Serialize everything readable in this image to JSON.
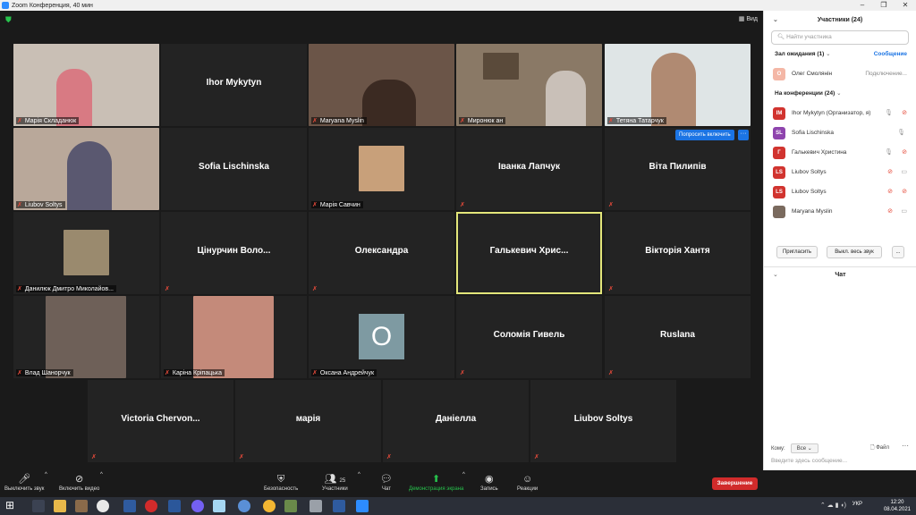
{
  "window": {
    "title": "Zoom Конференция, 40 мин",
    "minimize": "–",
    "maximize": "❐",
    "close": "✕"
  },
  "stage": {
    "view_label": "▦ Вид",
    "shield": "⛊"
  },
  "tiles": [
    {
      "id": "t1",
      "type": "video",
      "label": "Марія Складанюк",
      "muted": true
    },
    {
      "id": "t2",
      "type": "name",
      "name": "Ihor Mykytyn",
      "label": "",
      "muted": false
    },
    {
      "id": "t3",
      "type": "video",
      "label": "Maryana Myslin",
      "muted": true
    },
    {
      "id": "t4",
      "type": "video",
      "label": "Миронюк  ан",
      "muted": true
    },
    {
      "id": "t5",
      "type": "video",
      "label": "Тетяна Татарчук",
      "muted": true
    },
    {
      "id": "t6",
      "type": "video",
      "label": "Liubov Soltys",
      "muted": true
    },
    {
      "id": "t7",
      "type": "name",
      "name": "Sofia Lischinska",
      "label": "",
      "muted": false
    },
    {
      "id": "t8",
      "type": "photo",
      "label": "Марія Савчин",
      "muted": true
    },
    {
      "id": "t9",
      "type": "name",
      "name": "Іванка Лапчук",
      "label": "",
      "muted": true
    },
    {
      "id": "t10",
      "type": "name",
      "name": "Віта Пилипів",
      "label": "",
      "muted": true
    },
    {
      "id": "t11",
      "type": "photo",
      "label": "Данилюк Дмитро Миколайов...",
      "muted": true
    },
    {
      "id": "t12",
      "type": "name",
      "name": "Цінурчин  Воло...",
      "label": "",
      "muted": true
    },
    {
      "id": "t13",
      "type": "name",
      "name": "Олександра",
      "label": "",
      "muted": true
    },
    {
      "id": "t14",
      "type": "name",
      "name": "Галькевич  Хрис...",
      "label": "",
      "muted": false,
      "active": true
    },
    {
      "id": "t15",
      "type": "name",
      "name": "Вікторія Хантя",
      "label": "",
      "muted": true
    },
    {
      "id": "t16",
      "type": "photo",
      "label": "Влад Шанорчук",
      "muted": true
    },
    {
      "id": "t17",
      "type": "photo",
      "label": "Каріна Кріпацька",
      "muted": true
    },
    {
      "id": "t18",
      "type": "avatar",
      "avatar_letter": "О",
      "label": "Оксана Андрейчук",
      "muted": true
    },
    {
      "id": "t19",
      "type": "name",
      "name": "Соломія Гивель",
      "label": "",
      "muted": true
    },
    {
      "id": "t20",
      "type": "name",
      "name": "Ruslana",
      "label": "",
      "muted": true
    },
    {
      "id": "t21",
      "type": "name",
      "name": "Victoria  Chervon...",
      "label": "",
      "muted": true
    },
    {
      "id": "t22",
      "type": "name",
      "name": "марія",
      "label": "",
      "muted": true
    },
    {
      "id": "t23",
      "type": "name",
      "name": "Даніелла",
      "label": "",
      "muted": true
    },
    {
      "id": "t24",
      "type": "name",
      "name": "Liubov Soltys",
      "label": "",
      "muted": true
    }
  ],
  "ask_unmute": {
    "label": "Попросить включить",
    "more": "···"
  },
  "toolbar": {
    "mute": "Выключить звук",
    "video": "Включить видео",
    "security": "Безопасность",
    "participants": "Участники",
    "participants_count": "25",
    "chat": "Чат",
    "share": "Демонстрация экрана",
    "record": "Запись",
    "reactions": "Реакции",
    "end": "Завершение",
    "caret": "^"
  },
  "panel": {
    "title": "Участники (24)",
    "search_placeholder": "Найти участника",
    "waiting_section": "Зал ожидания  (1)",
    "waiting_action": "Сообщение",
    "waiting": [
      {
        "initial": "О",
        "name": "Олег Смолянін",
        "note": "Подключение...",
        "color": "#f4b7a6"
      }
    ],
    "in_meeting_section": "На конференции (24)",
    "participants": [
      {
        "initial": "IM",
        "name": "Ihor Mykytyn (Организатор, я)",
        "color": "#d1342f",
        "mic": "🎙",
        "cam": "⊘",
        "mic_red": false,
        "cam_red": true
      },
      {
        "initial": "SL",
        "name": "Sofia Lischinska",
        "color": "#8e44ad",
        "mic": "🎙",
        "cam": "",
        "mic_red": false,
        "cam_red": false
      },
      {
        "initial": "Г",
        "name": "Галькевич Христина",
        "color": "#d1342f",
        "mic": "🎙",
        "cam": "⊘",
        "mic_red": false,
        "cam_red": true
      },
      {
        "initial": "LS",
        "name": "Liubov Soltys",
        "color": "#d1342f",
        "mic": "⊘",
        "cam": "▭",
        "mic_red": true,
        "cam_red": false
      },
      {
        "initial": "LS",
        "name": "Liubov Soltys",
        "color": "#d1342f",
        "mic": "⊘",
        "cam": "⊘",
        "mic_red": true,
        "cam_red": true
      },
      {
        "initial": "",
        "name": "Maryana Myslin",
        "color": "#7a6a5e",
        "mic": "⊘",
        "cam": "▭",
        "mic_red": true,
        "cam_red": false
      }
    ],
    "invite": "Пригласить",
    "mute_all": "Выкл. весь звук",
    "more": "...",
    "chat_title": "Чат",
    "chat_to_label": "Кому:",
    "chat_to_value": "Все",
    "chat_file": "Файл",
    "chat_more": "···",
    "chat_placeholder": "Введите здесь сообщение..."
  },
  "taskbar": {
    "start": "⊞",
    "lang": "УКР",
    "time": "12:20",
    "date": "08.04.2021",
    "tray": "⌃ ☁ ▮ ◖)"
  }
}
